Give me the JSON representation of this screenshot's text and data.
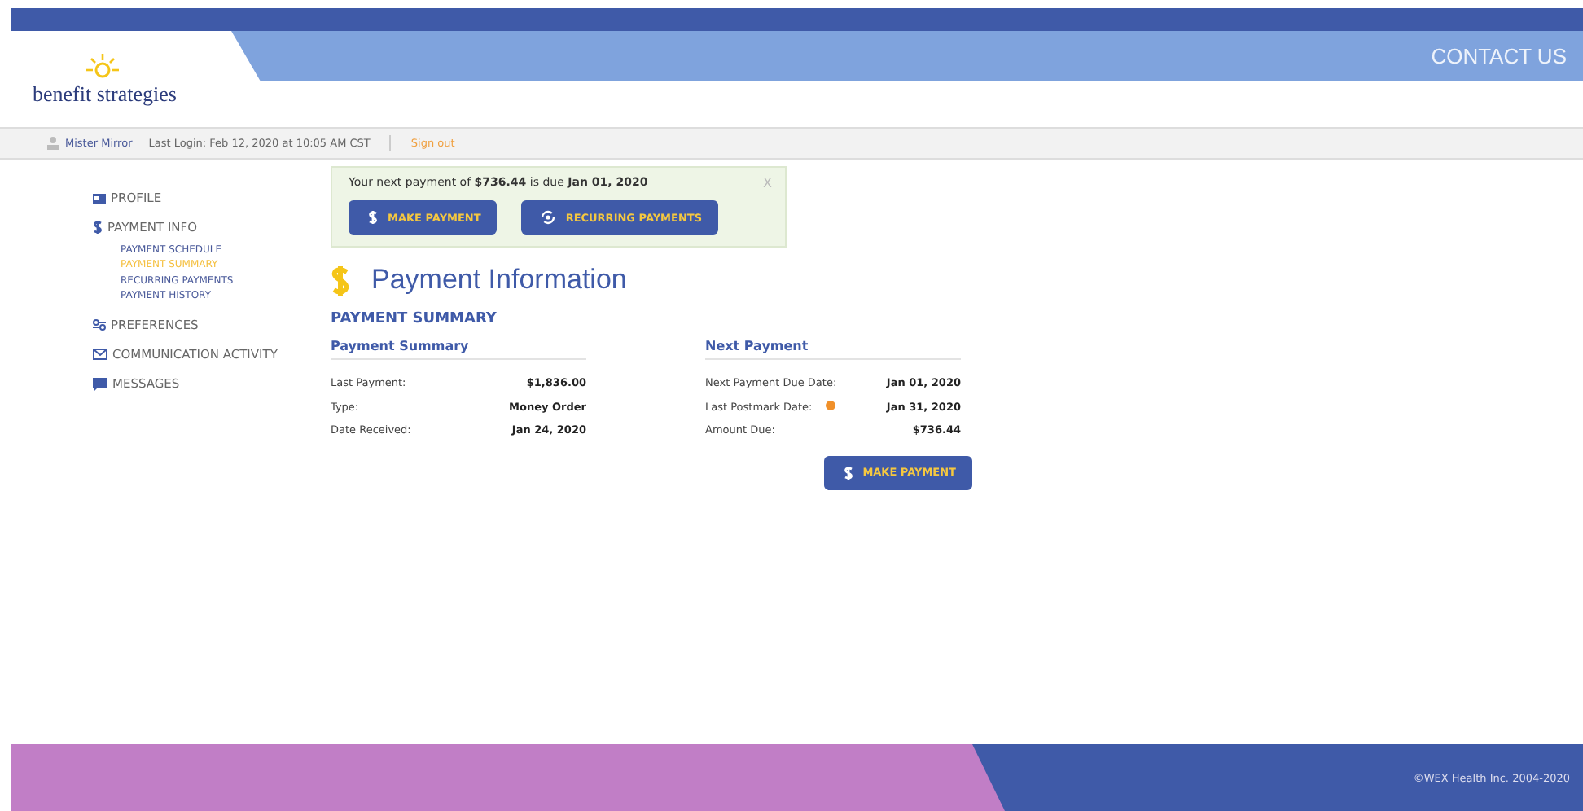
{
  "header": {
    "logo": "benefit strategies",
    "contact": "CONTACT US"
  },
  "user_bar": {
    "user": "Mister Mirror",
    "last_login": "Last Login: Feb 12, 2020 at 10:05 AM CST",
    "sign_out": "Sign out"
  },
  "sidebar": {
    "items": [
      {
        "label": "PROFILE"
      },
      {
        "label": "PAYMENT INFO",
        "children": [
          {
            "label": "PAYMENT SCHEDULE",
            "selected": false
          },
          {
            "label": "PAYMENT SUMMARY",
            "selected": true
          },
          {
            "label": "RECURRING PAYMENTS",
            "selected": false
          },
          {
            "label": "PAYMENT HISTORY",
            "selected": false
          }
        ]
      },
      {
        "label": "PREFERENCES"
      },
      {
        "label": "COMMUNICATION ACTIVITY"
      },
      {
        "label": "MESSAGES"
      }
    ]
  },
  "alert": {
    "message": "Your next payment of **$736.44** is due **Jan 01, 2020**",
    "close": "X",
    "buttons": [
      "MAKE PAYMENT",
      "RECURRING PAYMENTS"
    ]
  },
  "page_title": "Payment Information",
  "section_title": "PAYMENT SUMMARY",
  "panels": [
    {
      "title": "Payment Summary",
      "rows": [
        {
          "label": "Last Payment:",
          "value": "$1,836.00",
          "help": false
        },
        {
          "label": "Type:",
          "value": "Money Order",
          "help": false
        },
        {
          "label": "Date Received:",
          "value": "Jan 24, 2020",
          "help": false
        }
      ]
    },
    {
      "title": "Next Payment",
      "rows": [
        {
          "label": "Next Payment Due Date:",
          "value": "Jan 01, 2020",
          "help": false
        },
        {
          "label": "Last Postmark Date:",
          "value": "Jan 31, 2020",
          "help": true
        },
        {
          "label": "Amount Due:",
          "value": "$736.44",
          "help": false
        }
      ]
    }
  ],
  "make_payment": "MAKE PAYMENT",
  "footer": "©WEX Health Inc. 2004-2020"
}
